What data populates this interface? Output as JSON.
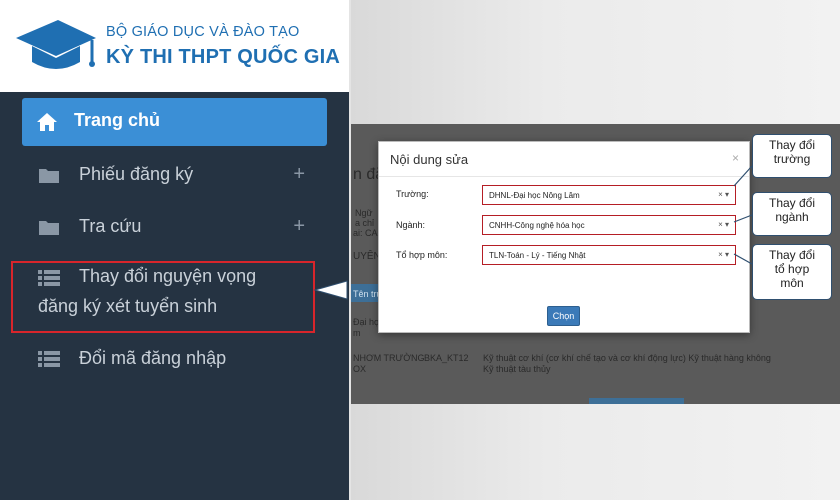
{
  "header": {
    "line1": "BỘ GIÁO DỤC VÀ ĐÀO TẠO",
    "line2": "KỲ THI THPT QUỐC GIA",
    "logo_icon": "graduation-cap-icon"
  },
  "sidebar": {
    "active": {
      "label": "Trang chủ",
      "icon": "home-icon"
    },
    "items": [
      {
        "label": "Phiếu đăng ký",
        "icon": "folder-icon",
        "expand": "+"
      },
      {
        "label": "Tra cứu",
        "icon": "folder-icon",
        "expand": "+"
      },
      {
        "label_line1": "Thay đổi nguyện vọng",
        "label_line2": "đăng ký xét tuyển sinh",
        "icon": "list-icon"
      },
      {
        "label": "Đổi mã đăng nhập",
        "icon": "list-icon"
      }
    ]
  },
  "background": {
    "heading_fragment": "n đă",
    "row1_a": "Ngữ",
    "row1_b": "a chỉ",
    "row1_c": "ai: CAN",
    "row2": "UYÊN",
    "row3": "Tên trườ",
    "row4_a": "Đại học",
    "row4_b": "m",
    "row5_a": "NHƠM TRƯỜNG",
    "row5_b": "OX",
    "row5_code": "BKA_KT12",
    "row5_desc": "Kỹ thuật cơ khí (cơ khí chế tạo và cơ khí động lực) Kỹ thuật hàng không",
    "row5_desc2": "Kỹ thuật tàu thủy"
  },
  "modal": {
    "title": "Nội dung sửa",
    "close": "×",
    "fields": [
      {
        "label": "Trường:",
        "value": "DHNL-Đại học Nông Lâm"
      },
      {
        "label": "Ngành:",
        "value": "CNHH-Công nghệ hóa học"
      },
      {
        "label": "Tổ hợp môn:",
        "value": "TLN-Toán - Lý - Tiếng Nhật"
      }
    ],
    "select_ctrl": "× ▾",
    "button": "Chọn"
  },
  "callouts": [
    {
      "line1": "Thay đổi",
      "line2": "trường"
    },
    {
      "line1": "Thay đổi",
      "line2": "ngành"
    },
    {
      "line1": "Thay đổi",
      "line2": "tổ hợp",
      "line3": "môn"
    }
  ],
  "colors": {
    "brand_blue": "#1f6fb2",
    "sidebar_bg": "#253342",
    "active_item": "#3b8fd6",
    "highlight_red": "#d8252b"
  }
}
